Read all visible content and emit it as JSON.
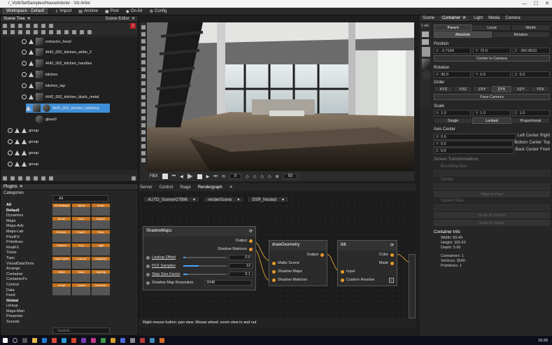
{
  "window": {
    "title": "/_Viz6/SetSamples/HouseInterior - Viz Artist",
    "controls": [
      "—",
      "☐",
      "✕"
    ]
  },
  "menu": {
    "workspace": "Workspace - Default",
    "items": [
      "Import",
      "Archive",
      "Post",
      "On Air",
      "Config"
    ]
  },
  "scene_tree": {
    "tabs": [
      "Scene Tree",
      "Scene Editor"
    ],
    "badge": "1",
    "rows": [
      {
        "label": "extractor_hood",
        "selected": false
      },
      {
        "label": "AI42_002_kitchen_white_2",
        "selected": false
      },
      {
        "label": "AI42_002_kitchen_handles",
        "selected": false
      },
      {
        "label": "kitchen",
        "selected": false
      },
      {
        "label": "kitchen_tap",
        "selected": false
      },
      {
        "label": "AI42_002_kitchen_black_metal",
        "selected": false
      },
      {
        "label": "AI42_002_kitchen_tabletop",
        "selected": true
      },
      {
        "label": "glass3",
        "selected": false
      },
      {
        "label": "group",
        "selected": false
      },
      {
        "label": "group",
        "selected": false
      },
      {
        "label": "group",
        "selected": false
      },
      {
        "label": "group",
        "selected": false
      }
    ]
  },
  "viewport": {
    "fbx": "FBX",
    "frame": "0",
    "fps": "50"
  },
  "graph": {
    "top_tabs": [
      "Server",
      "Control",
      "Stage",
      "Rendergraph"
    ],
    "sub_tabs": [
      "AUTO_Scene#27996",
      "renderScene",
      "SSR_Nested"
    ],
    "shadowmaps": {
      "title": "ShadowMaps",
      "outputs": [
        "Output",
        "Shadow Matrices"
      ],
      "params": [
        {
          "label": "Lookup Offset",
          "value": "0.0",
          "fill": 0.05
        },
        {
          "label": "PCF Samples",
          "value": "12",
          "fill": 0.35
        },
        {
          "label": "Step Size Factor",
          "value": "0.1",
          "fill": 0.1
        }
      ],
      "resolution_label": "Shadow Map Resolution",
      "resolution_value": "2048"
    },
    "drawgeometry": {
      "title": "drawGeometry",
      "output": "Output",
      "inputs": [
        "Matte Scene",
        "Shadow Maps",
        "Shadow Matrices"
      ]
    },
    "blit": {
      "title": "blit",
      "outputs": [
        "Color",
        "Mask"
      ],
      "inputs": [
        "Input",
        "Custom Resolve"
      ]
    },
    "status": "Right mouse button: pan view. Mouse wheel: zoom view in and out"
  },
  "plugins": {
    "tab": "Plugins",
    "header": "Categories",
    "filter": "All",
    "categories": [
      {
        "label": "All",
        "bold": true
      },
      {
        "label": "Default",
        "bold": true
      },
      {
        "label": "Dynamics",
        "bold": false
      },
      {
        "label": "Maps",
        "bold": false
      },
      {
        "label": "Maps-Adv",
        "bold": false
      },
      {
        "label": "Maps-Lab",
        "bold": false
      },
      {
        "label": "PixelFX",
        "bold": false
      },
      {
        "label": "Primitives",
        "bold": false
      },
      {
        "label": "RealFX",
        "bold": false
      },
      {
        "label": "Ticker",
        "bold": false
      },
      {
        "label": "Topo",
        "bold": false
      },
      {
        "label": "VisualDataTools",
        "bold": false
      },
      {
        "label": "Arrange",
        "bold": false
      },
      {
        "label": "Container",
        "bold": false
      },
      {
        "label": "ContainerFx",
        "bold": false
      },
      {
        "label": "Control",
        "bold": false
      },
      {
        "label": "Data",
        "bold": false
      },
      {
        "label": "Feed",
        "bold": false
      },
      {
        "label": "Global",
        "bold": true
      },
      {
        "label": "Lineup",
        "bold": false
      },
      {
        "label": "Maps-Man",
        "bold": false
      },
      {
        "label": "Presenter",
        "bold": false
      },
      {
        "label": "Sounds",
        "bold": false
      }
    ],
    "items": [
      "3D Settings",
      "Alpha",
      "Audio",
      "Brush",
      "Color",
      "Clipper",
      "Environ.",
      "Expert",
      "Glow",
      "Infotext",
      "Key",
      "Light",
      "Light Layer",
      "Look at",
      "Mapping",
      "Mask",
      "Mask",
      "Lighting",
      "Script",
      "Caster",
      "Receiver"
    ],
    "search": "Search..."
  },
  "properties": {
    "tabs": [
      "Scene",
      "Container",
      "Light",
      "Media",
      "Camera"
    ],
    "side_label": "1 sel.",
    "parent_toggle": [
      "Parent",
      "Local",
      "World"
    ],
    "abs_toggle": [
      "Absolute",
      "Relative"
    ],
    "position": {
      "label": "Position",
      "x": "-2.7164",
      "y": "72.0",
      "z": "-350.8510"
    },
    "center_camera": "Center to Camera",
    "rotation": {
      "label": "Rotation",
      "x": "90.0",
      "y": "0.0",
      "z": "0.0"
    },
    "order": {
      "label": "Order",
      "options": [
        "XYZ",
        "YXZ",
        "ZXY",
        "ZYX",
        "XZY",
        "YZX"
      ],
      "selected": "ZYX"
    },
    "face_camera": "Face Camera",
    "scale": {
      "label": "Scale",
      "x": "1.0",
      "y": "1.0",
      "z": "1.0",
      "modes": [
        "Single",
        "Locked",
        "Proportional"
      ],
      "selected": "Locked"
    },
    "axis_center": {
      "label": "Axis Center",
      "x": "0.0",
      "y": "0.0",
      "z": "0.0",
      "xbtn": [
        "Left",
        "Center",
        "Right"
      ],
      "ybtn": [
        "Bottom",
        "Center",
        "Top"
      ],
      "zbtn": [
        "Back",
        "Center",
        "Front"
      ]
    },
    "screen_transform": {
      "label": "Screen Transformations",
      "bbox": "Bounding Box",
      "center": "Center",
      "align": "Align to Pixel",
      "size": "Screen Size",
      "scale_screen": "Scale to Screen",
      "scale_image": "Scale to Image"
    },
    "info": {
      "label": "Container Info",
      "width": "Width:  69.49",
      "height": "Height: 325.62",
      "depth": "Depth:  5.00",
      "containers": "Containers: 1",
      "vertices": "Vertices:   3540",
      "primitives": "Primitives: 1"
    }
  },
  "taskbar": {
    "clock": "10:25"
  }
}
